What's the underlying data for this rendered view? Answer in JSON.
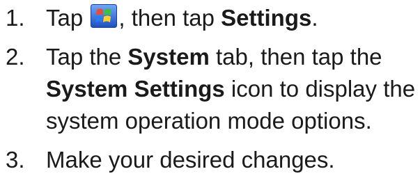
{
  "steps": [
    {
      "number": "1.",
      "pre": "Tap",
      "icon": "windows-start-icon",
      "mid": ", then tap",
      "bold": "Settings",
      "post": "."
    },
    {
      "number": "2.",
      "pre": "Tap the",
      "bold1": "System",
      "mid": "tab, then tap the",
      "bold2": "System Settings",
      "post1": "icon to display the",
      "line3": "system operation mode options."
    },
    {
      "number": "3.",
      "text": "Make your desired changes."
    }
  ]
}
